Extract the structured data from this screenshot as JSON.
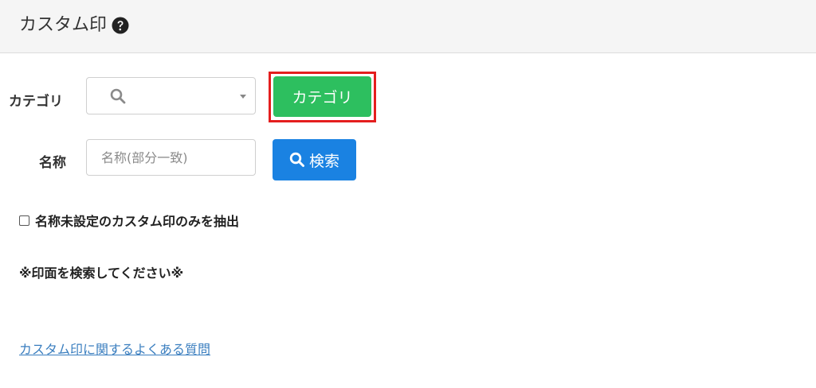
{
  "header": {
    "title": "カスタム印",
    "help_icon": "question-circle-icon"
  },
  "filters": {
    "category_label": "カテゴリ",
    "category_select_value": "",
    "category_button_label": "カテゴリ",
    "name_label": "名称",
    "name_placeholder": "名称(部分一致)",
    "name_value": "",
    "search_button_label": "検索",
    "search_icon": "search-icon"
  },
  "options": {
    "unnamed_only_label": "名称未設定のカスタム印のみを抽出",
    "unnamed_only_checked": false
  },
  "results": {
    "notice": "※印面を検索してください※"
  },
  "footer": {
    "faq_link_label": "カスタム印に関するよくある質問"
  },
  "colors": {
    "category_button": "#2dbf5f",
    "search_button": "#1a82e2",
    "highlight": "#e41e1e",
    "link": "#3a7ebf"
  }
}
